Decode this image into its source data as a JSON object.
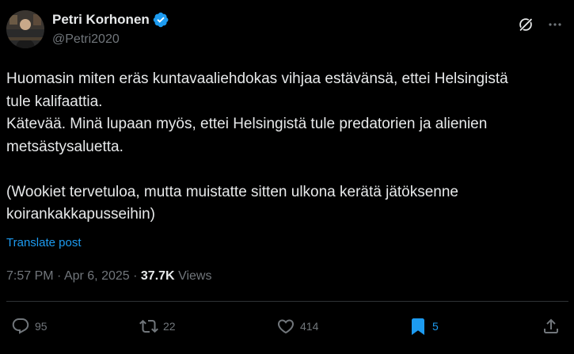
{
  "author": {
    "name": "Petri Korhonen",
    "handle": "@Petri2020",
    "verified": true
  },
  "post": {
    "lines": [
      "Huomasin miten eräs kuntavaaliehdokas vihjaa estävänsä, ettei Helsingistä",
      "tule kalifaattia.",
      "Kätevää. Minä lupaan myös, ettei Helsingistä tule predatorien ja alienien",
      "metsästysaluetta.",
      "",
      "(Wookiet tervetuloa, mutta muistatte sitten ulkona kerätä jätöksenne",
      "koirankakkapusseihin)"
    ],
    "translate_label": "Translate post"
  },
  "meta": {
    "time": "7:57 PM",
    "separator": "·",
    "date": "Apr 6, 2025",
    "views_count": "37.7K",
    "views_label": "Views"
  },
  "actions": {
    "replies": "95",
    "reposts": "22",
    "likes": "414",
    "bookmarks": "5"
  },
  "icons": {
    "verified": "verified-badge-icon",
    "grok": "grok-icon",
    "more": "more-dots-icon",
    "reply": "reply-icon",
    "repost": "repost-icon",
    "like": "heart-icon",
    "bookmark": "bookmark-icon",
    "share": "share-icon"
  },
  "colors": {
    "background": "#000000",
    "text": "#e7e9ea",
    "muted": "#71767b",
    "accent": "#1d9bf0",
    "divider": "#2f3336"
  }
}
